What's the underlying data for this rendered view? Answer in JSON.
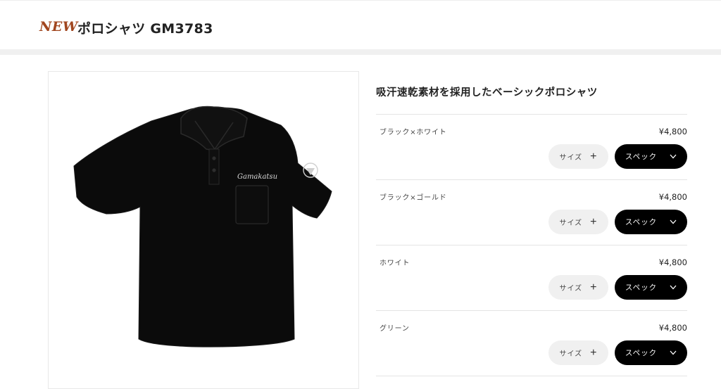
{
  "header": {
    "badge": "NEW",
    "title": "ポロシャツ GM3783"
  },
  "product": {
    "image_icon": "black-polo-shirt",
    "image_logo_text": "Gamakatsu",
    "headline": "吸汗速乾素材を採用したベーシックポロシャツ"
  },
  "variants": [
    {
      "name": "ブラック×ホワイト",
      "price": "¥4,800",
      "size_label": "サイズ",
      "spec_label": "スペック"
    },
    {
      "name": "ブラック×ゴールド",
      "price": "¥4,800",
      "size_label": "サイズ",
      "spec_label": "スペック"
    },
    {
      "name": "ホワイト",
      "price": "¥4,800",
      "size_label": "サイズ",
      "spec_label": "スペック"
    },
    {
      "name": "グリーン",
      "price": "¥4,800",
      "size_label": "サイズ",
      "spec_label": "スペック"
    }
  ],
  "icons": {
    "size_button": "plus-icon",
    "spec_button": "chevron-down-icon"
  },
  "colors": {
    "badge": "#a1461f",
    "spec_button_bg": "#000000",
    "size_button_bg": "#f0f0f0"
  }
}
